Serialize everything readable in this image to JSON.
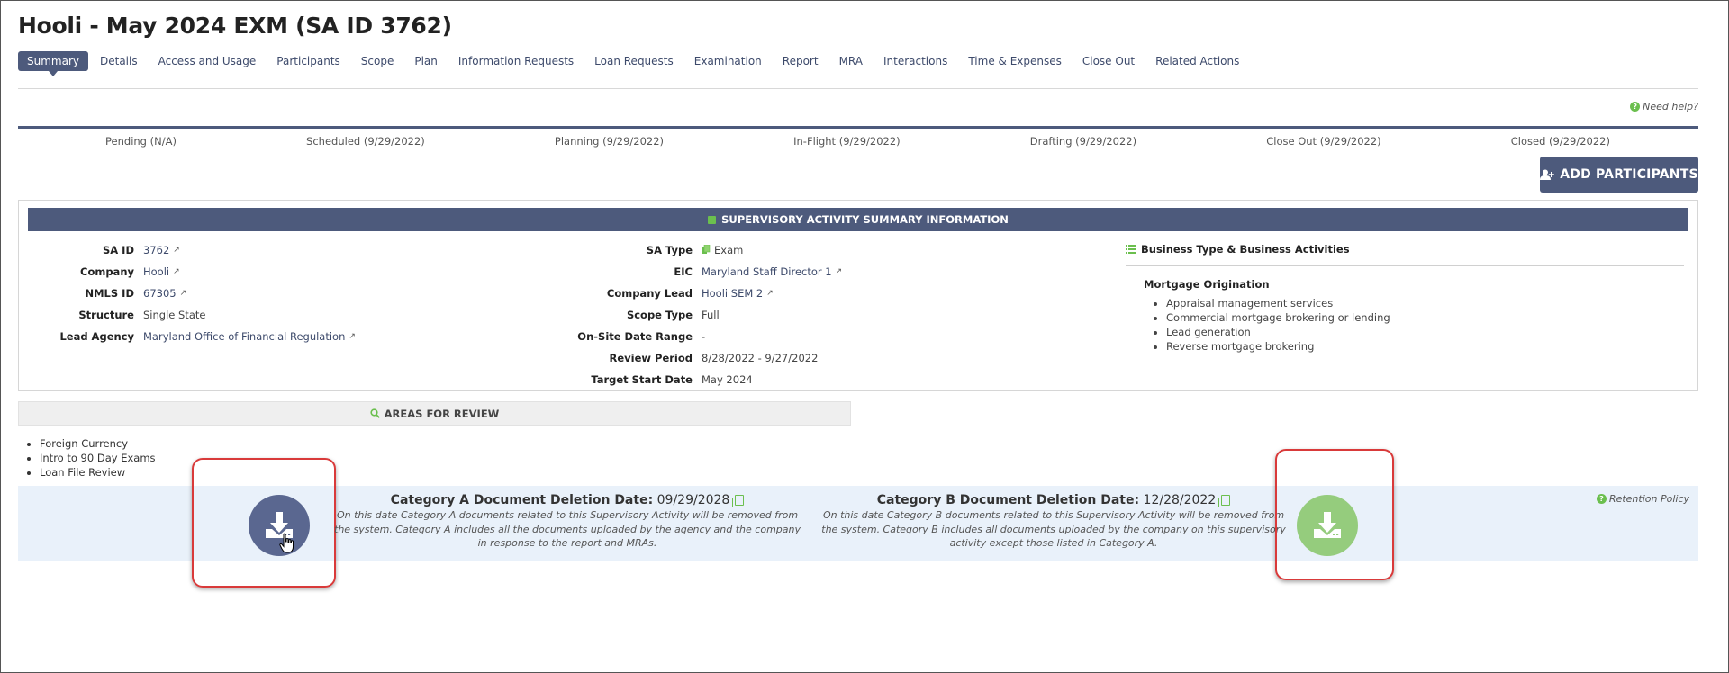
{
  "page": {
    "title": "Hooli - May 2024 EXM (SA ID 3762)",
    "need_help": "Need help?"
  },
  "tabs": [
    {
      "label": "Summary",
      "active": true
    },
    {
      "label": "Details"
    },
    {
      "label": "Access and Usage"
    },
    {
      "label": "Participants"
    },
    {
      "label": "Scope"
    },
    {
      "label": "Plan"
    },
    {
      "label": "Information Requests"
    },
    {
      "label": "Loan Requests"
    },
    {
      "label": "Examination"
    },
    {
      "label": "Report"
    },
    {
      "label": "MRA"
    },
    {
      "label": "Interactions"
    },
    {
      "label": "Time & Expenses"
    },
    {
      "label": "Close Out"
    },
    {
      "label": "Related Actions"
    }
  ],
  "statuses": [
    "Pending (N/A)",
    "Scheduled (9/29/2022)",
    "Planning (9/29/2022)",
    "In-Flight (9/29/2022)",
    "Drafting (9/29/2022)",
    "Close Out (9/29/2022)",
    "Closed (9/29/2022)"
  ],
  "add_participants_label": "ADD PARTICIPANTS",
  "summary": {
    "header": "SUPERVISORY ACTIVITY SUMMARY INFORMATION",
    "left": [
      {
        "key": "SA ID",
        "value": "3762",
        "link": true
      },
      {
        "key": "Company",
        "value": "Hooli",
        "link": true
      },
      {
        "key": "NMLS ID",
        "value": "67305",
        "link": true
      },
      {
        "key": "Structure",
        "value": "Single State",
        "link": false
      },
      {
        "key": "Lead Agency",
        "value": "Maryland Office of Financial Regulation",
        "link": true
      }
    ],
    "middle": [
      {
        "key": "SA Type",
        "value": "Exam",
        "icon": true
      },
      {
        "key": "EIC",
        "value": "Maryland Staff Director 1",
        "link": true
      },
      {
        "key": "Company Lead",
        "value": "Hooli SEM 2",
        "link": true
      },
      {
        "key": "Scope Type",
        "value": "Full"
      },
      {
        "key": "On-Site Date Range",
        "value": "-"
      },
      {
        "key": "Review Period",
        "value": "8/28/2022 - 9/27/2022"
      },
      {
        "key": "Target Start Date",
        "value": "May 2024"
      }
    ],
    "business_header": "Business Type & Business Activities",
    "business_type": "Mortgage Origination",
    "business_activities": [
      "Appraisal management services",
      "Commercial mortgage brokering or lending",
      "Lead generation",
      "Reverse mortgage brokering"
    ]
  },
  "areas": {
    "header": "AREAS FOR REVIEW",
    "items": [
      "Foreign Currency",
      "Intro to 90 Day Exams",
      "Loan File Review"
    ]
  },
  "retention": {
    "cat_a_title": "Category A Document Deletion Date:",
    "cat_a_date": "09/29/2028",
    "cat_a_desc": "On this date Category A documents related to this Supervisory Activity will be removed from the system. Category A includes all the documents uploaded by the agency and the company in response to the report and MRAs.",
    "cat_b_title": "Category B Document Deletion Date:",
    "cat_b_date": "12/28/2022",
    "cat_b_desc": "On this date Category B documents related to this Supervisory Activity will be removed from the system. Category B includes all documents uploaded by the company on this supervisory activity except those listed in Category A.",
    "policy_label": "Retention Policy"
  },
  "colors": {
    "primary": "#4d5a7c",
    "accent_green": "#6bbf4e",
    "highlight_red": "#d93a3a",
    "retention_bg": "#e9f1fa"
  }
}
